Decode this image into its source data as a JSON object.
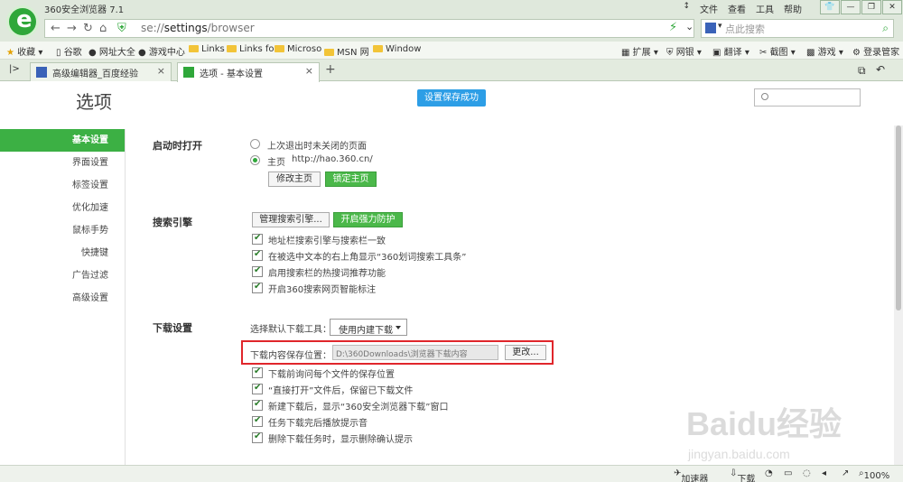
{
  "app": {
    "title": "360安全浏览器 7.1"
  },
  "menu": {
    "file": "文件",
    "view": "查看",
    "tools": "工具",
    "help": "帮助"
  },
  "address": {
    "scheme": "se://",
    "path": "settings",
    "rest": "/browser"
  },
  "search": {
    "placeholder": "点此搜索"
  },
  "bookmarks": {
    "favorites": "收藏",
    "items": [
      "谷歌",
      "网址大全",
      "游戏中心",
      "Links",
      "Links fo",
      "Microso",
      "MSN 网",
      "Window"
    ],
    "right": [
      "扩展",
      "网银",
      "翻译",
      "截图",
      "游戏",
      "登录管家"
    ]
  },
  "tabs": [
    {
      "label": "高级编辑器_百度经验"
    },
    {
      "label": "选项 - 基本设置"
    }
  ],
  "page": {
    "title": "选项",
    "saved": "设置保存成功"
  },
  "sidebar": {
    "items": [
      "基本设置",
      "界面设置",
      "标签设置",
      "优化加速",
      "鼠标手势",
      "快捷键",
      "广告过滤",
      "高级设置"
    ]
  },
  "startup": {
    "title": "启动时打开",
    "opt_last": "上次退出时未关闭的页面",
    "opt_home": "主页",
    "home_url": "http://hao.360.cn/",
    "modify": "修改主页",
    "lock": "锁定主页"
  },
  "search_engine": {
    "title": "搜索引擎",
    "manage": "管理搜索引擎...",
    "protect": "开启强力防护",
    "checks": [
      "地址栏搜索引擎与搜索栏一致",
      "在被选中文本的右上角显示“360划词搜索工具条”",
      "启用搜索栏的热搜词推荐功能",
      "开启360搜索网页智能标注"
    ]
  },
  "download": {
    "title": "下载设置",
    "tool_label": "选择默认下载工具：",
    "tool_value": "使用内建下载",
    "path_label": "下载内容保存位置：",
    "path_value": "D:\\360Downloads\\浏览器下载内容",
    "change": "更改...",
    "checks": [
      "下载前询问每个文件的保存位置",
      "“直接打开”文件后，保留已下载文件",
      "新建下载后，显示“360安全浏览器下载”窗口",
      "任务下载完后播放提示音",
      "删除下载任务时，显示删除确认提示"
    ]
  },
  "status": {
    "accelerator": "加速器",
    "download": "下载",
    "zoom": "100%"
  },
  "watermark": {
    "brand": "Baidu经验",
    "domain": "jingyan.baidu.com"
  },
  "colors": {
    "accent": "#3cb044",
    "saved_badge": "#2d9ee6",
    "highlight": "#e0262b"
  }
}
